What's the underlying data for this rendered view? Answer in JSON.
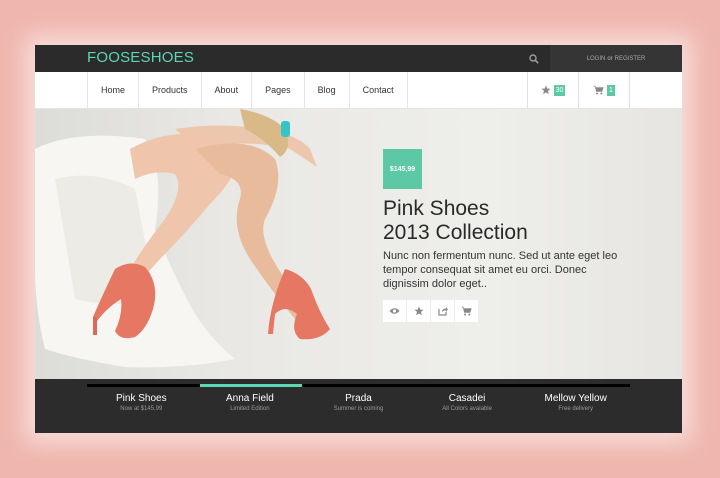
{
  "colors": {
    "accent": "#5cc8a6",
    "logo": "#5cd6b5",
    "dark": "#2b2b2b",
    "background": "#efb6ad"
  },
  "header": {
    "logo": "FOOSESHOES",
    "search_icon": "search-icon",
    "login": "LOGIN",
    "or": "or",
    "register": "REGISTER"
  },
  "nav": {
    "items": [
      "Home",
      "Products",
      "About",
      "Pages",
      "Blog",
      "Contact"
    ],
    "favorites_icon": "star-icon",
    "favorites_count": "30",
    "cart_icon": "cart-icon",
    "cart_count": "1"
  },
  "hero": {
    "price": "$145,99",
    "title_line1": "Pink Shoes",
    "title_line2": "2013 Collection",
    "description": "Nunc non fermentum nunc. Sed ut ante eget leo tempor consequat sit amet eu orci. Donec dignissim dolor eget..",
    "actions": [
      "eye-icon",
      "star-icon",
      "share-icon",
      "cart-icon"
    ]
  },
  "slider": {
    "active_index": 1,
    "items": [
      {
        "title": "Pink Shoes",
        "subtitle": "Now at $145,99"
      },
      {
        "title": "Anna Field",
        "subtitle": "Limited Edition"
      },
      {
        "title": "Prada",
        "subtitle": "Summer is coming"
      },
      {
        "title": "Casadei",
        "subtitle": "All Colors avaiable"
      },
      {
        "title": "Mellow Yellow",
        "subtitle": "Free delivery"
      }
    ]
  }
}
